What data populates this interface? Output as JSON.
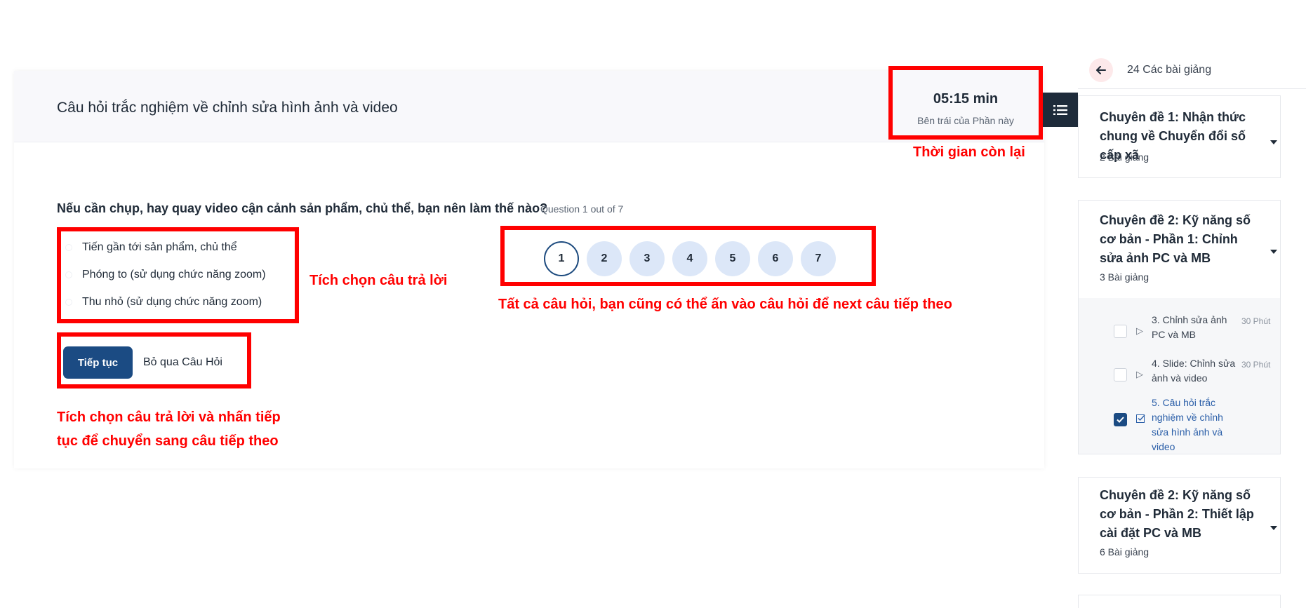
{
  "quiz": {
    "title": "Câu hỏi trắc nghiệm về chỉnh sửa hình ảnh và video",
    "timer": {
      "value": "05:15 min",
      "label": "Bên trái của Phần này"
    },
    "question": "Nếu cần chụp, hay quay video cận cảnh sản phẩm, chủ thể, bạn nên làm thế nào?",
    "progress": "Question 1 out of 7",
    "answers": [
      "Tiến gần tới sản phẩm, chủ thể",
      "Phóng to (sử dụng chức năng zoom)",
      "Thu nhỏ (sử dụng chức năng zoom)"
    ],
    "question_numbers": [
      "1",
      "2",
      "3",
      "4",
      "5",
      "6",
      "7"
    ],
    "active_question": "1",
    "next_label": "Tiếp tục",
    "skip_label": "Bỏ qua Câu Hỏi"
  },
  "annotations": {
    "timer": "Thời gian còn lại",
    "answers": "Tích chọn câu trả lời",
    "navigator": "Tất cả câu hỏi, bạn cũng có thể ấn vào câu hỏi để next câu tiếp theo",
    "actions_line1": "Tích chọn câu trả lời  và nhấn tiếp",
    "actions_line2": "tục để chuyển sang câu tiếp theo"
  },
  "sidebar": {
    "lessons_count": "24 Các bài giảng",
    "sections": [
      {
        "title": "Chuyên đề 1: Nhận thức chung về Chuyển đổi số cấp xã",
        "count": "2 Bài giảng"
      },
      {
        "title": "Chuyên đề 2: Kỹ năng số cơ bản - Phần 1: Chỉnh sửa ảnh PC và MB",
        "count": "3 Bài giảng"
      },
      {
        "title": "Chuyên đề 2: Kỹ năng số cơ bản - Phần 2: Thiết lập cài đặt PC và MB",
        "count": "6 Bài giảng"
      }
    ],
    "lessons": [
      {
        "title": "3. Chỉnh sửa ảnh PC và MB",
        "duration": "30 Phút",
        "icon": "play-icon",
        "done": false
      },
      {
        "title": "4. Slide: Chỉnh sửa ảnh và video",
        "duration": "30 Phút",
        "icon": "play-icon",
        "done": false
      },
      {
        "title": "5. Câu hỏi trắc nghiệm về chỉnh sửa hình ảnh và video",
        "duration": "",
        "icon": "quiz-check-icon",
        "done": true
      }
    ]
  },
  "colors": {
    "annotation_red": "#ff0000",
    "primary_blue": "#1b4b83",
    "bubble_bg": "#dce7f8",
    "header_bg": "#f8f8fb",
    "sidebar_toggle_bg": "#1e2b3a"
  }
}
